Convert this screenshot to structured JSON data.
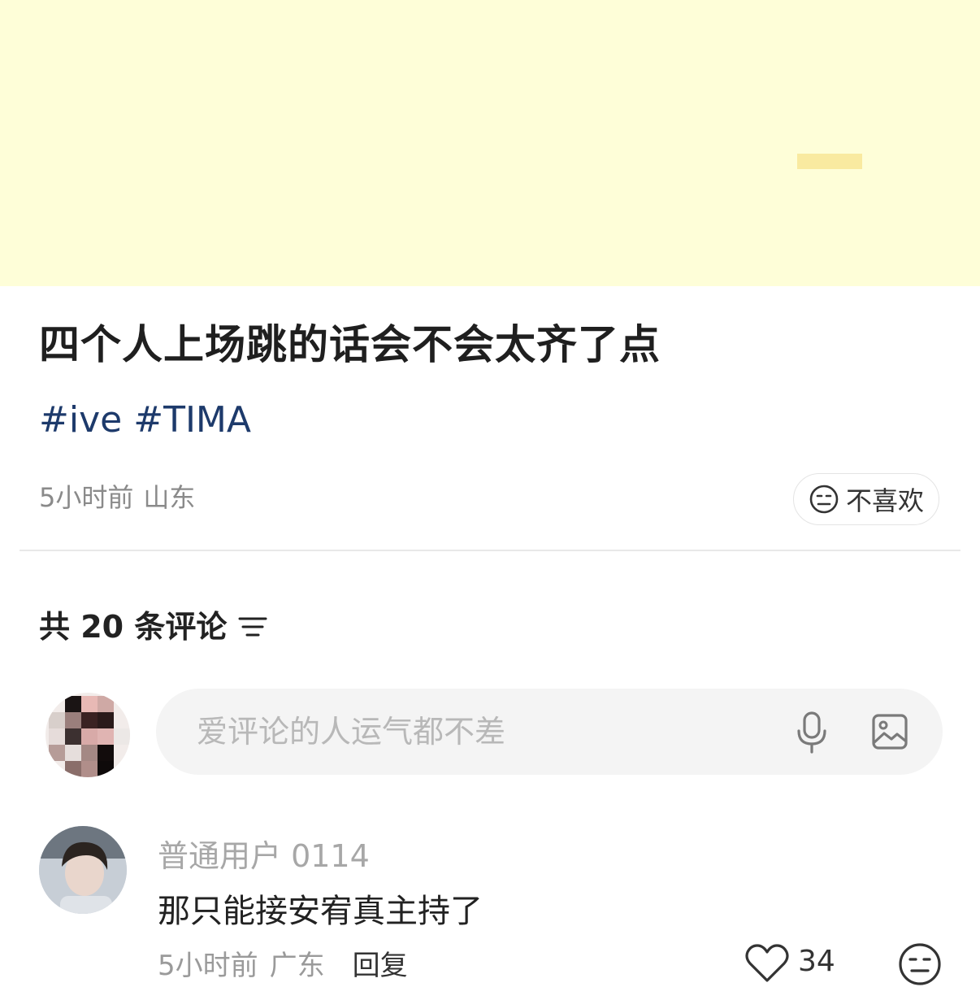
{
  "post": {
    "title": "四个人上场跳的话会不会太齐了点",
    "tags": [
      "#ive",
      "#TIMA"
    ],
    "time": "5小时前",
    "location": "山东",
    "dislike_label": "不喜欢"
  },
  "comments_header": {
    "count_label": "共 20 条评论"
  },
  "comment_input": {
    "placeholder": "爱评论的人运气都不差"
  },
  "comments": [
    {
      "username": "普通用户 0114",
      "text": "那只能接安宥真主持了",
      "time": "5小时前",
      "location": "广东",
      "reply_label": "回复",
      "likes": "34"
    }
  ],
  "colors": {
    "media_bg": "#fefed8",
    "tag_link": "#1d3a6b",
    "muted": "#8a8a8a"
  },
  "icons": [
    "dislike-face-icon",
    "sort-icon",
    "microphone-icon",
    "image-icon",
    "heart-icon",
    "reaction-face-icon"
  ]
}
